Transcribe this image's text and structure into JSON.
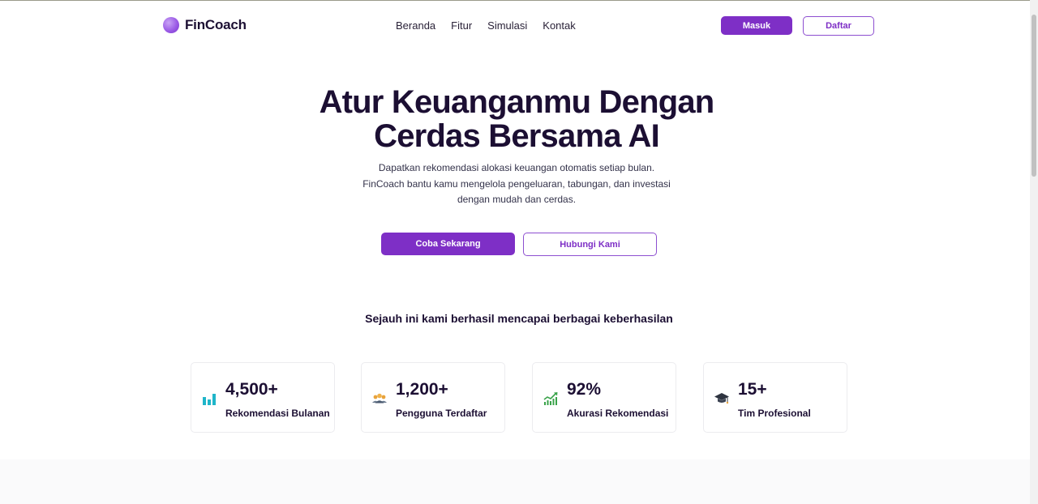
{
  "brand": {
    "name": "FinCoach"
  },
  "nav": {
    "links": [
      "Beranda",
      "Fitur",
      "Simulasi",
      "Kontak"
    ],
    "login_label": "Masuk",
    "register_label": "Daftar"
  },
  "hero": {
    "title_line1": "Atur Keuanganmu Dengan",
    "title_line2": "Cerdas Bersama AI",
    "subtitle_line1": "Dapatkan rekomendasi alokasi keuangan otomatis setiap bulan.",
    "subtitle_line2": "FinCoach bantu kamu mengelola pengeluaran, tabungan, dan investasi",
    "subtitle_line3": "dengan mudah dan cerdas.",
    "primary_cta": "Coba Sekarang",
    "secondary_cta": "Hubungi Kami"
  },
  "stats": {
    "heading": "Sejauh ini kami berhasil mencapai berbagai keberhasilan",
    "items": [
      {
        "value": "4,500+",
        "label": "Rekomendasi Bulanan",
        "icon": "bar-chart-icon"
      },
      {
        "value": "1,200+",
        "label": "Pengguna Terdaftar",
        "icon": "users-icon"
      },
      {
        "value": "92%",
        "label": "Akurasi Rekomendasi",
        "icon": "trend-up-icon"
      },
      {
        "value": "15+",
        "label": "Tim Profesional",
        "icon": "graduation-cap-icon"
      }
    ]
  },
  "colors": {
    "accent": "#7e2fc6",
    "heading": "#1c0f33",
    "bar_icon": "#1fb5c9",
    "trend_icon": "#3aa34a"
  }
}
